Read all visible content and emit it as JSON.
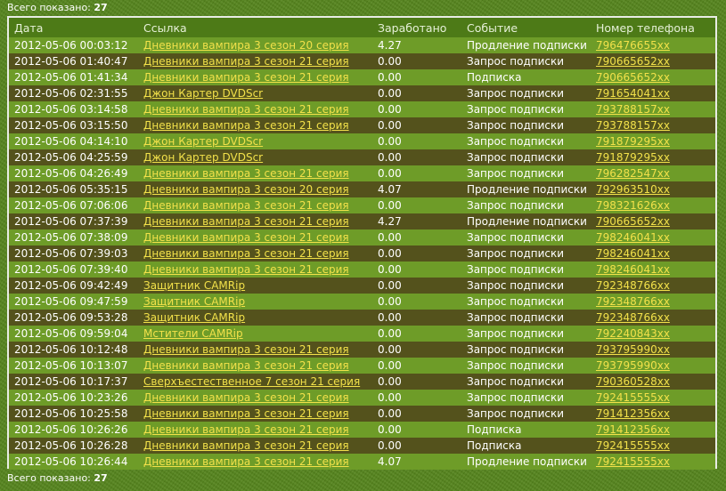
{
  "summary": {
    "label": "Всего показано:",
    "count": "27"
  },
  "columns": [
    "Дата",
    "Ссылка",
    "Заработано",
    "Событие",
    "Номер телефона"
  ],
  "rows": [
    {
      "date": "2012-05-06 00:03:12",
      "link": "Дневники вампира 3 сезон 20 серия",
      "earned": "4.27",
      "event": "Продление подписки",
      "phone": "796476655xx"
    },
    {
      "date": "2012-05-06 01:40:47",
      "link": "Дневники вампира 3 сезон 21 серия",
      "earned": "0.00",
      "event": "Запрос подписки",
      "phone": "790665652xx"
    },
    {
      "date": "2012-05-06 01:41:34",
      "link": "Дневники вампира 3 сезон 21 серия",
      "earned": "0.00",
      "event": "Подписка",
      "phone": "790665652xx"
    },
    {
      "date": "2012-05-06 02:31:55",
      "link": "Джон Картер DVDScr",
      "earned": "0.00",
      "event": "Запрос подписки",
      "phone": "791654041xx"
    },
    {
      "date": "2012-05-06 03:14:58",
      "link": "Дневники вампира 3 сезон 21 серия",
      "earned": "0.00",
      "event": "Запрос подписки",
      "phone": "793788157xx"
    },
    {
      "date": "2012-05-06 03:15:50",
      "link": "Дневники вампира 3 сезон 21 серия",
      "earned": "0.00",
      "event": "Запрос подписки",
      "phone": "793788157xx"
    },
    {
      "date": "2012-05-06 04:14:10",
      "link": "Джон Картер DVDScr",
      "earned": "0.00",
      "event": "Запрос подписки",
      "phone": "791879295xx"
    },
    {
      "date": "2012-05-06 04:25:59",
      "link": "Джон Картер DVDScr",
      "earned": "0.00",
      "event": "Запрос подписки",
      "phone": "791879295xx"
    },
    {
      "date": "2012-05-06 04:26:49",
      "link": "Дневники вампира 3 сезон 21 серия",
      "earned": "0.00",
      "event": "Запрос подписки",
      "phone": "796282547xx"
    },
    {
      "date": "2012-05-06 05:35:15",
      "link": "Дневники вампира 3 сезон 20 серия",
      "earned": "4.07",
      "event": "Продление подписки",
      "phone": "792963510xx"
    },
    {
      "date": "2012-05-06 07:06:06",
      "link": "Дневники вампира 3 сезон 21 серия",
      "earned": "0.00",
      "event": "Запрос подписки",
      "phone": "798321626xx"
    },
    {
      "date": "2012-05-06 07:37:39",
      "link": "Дневники вампира 3 сезон 21 серия",
      "earned": "4.27",
      "event": "Продление подписки",
      "phone": "790665652xx"
    },
    {
      "date": "2012-05-06 07:38:09",
      "link": "Дневники вампира 3 сезон 21 серия",
      "earned": "0.00",
      "event": "Запрос подписки",
      "phone": "798246041xx"
    },
    {
      "date": "2012-05-06 07:39:03",
      "link": "Дневники вампира 3 сезон 21 серия",
      "earned": "0.00",
      "event": "Запрос подписки",
      "phone": "798246041xx"
    },
    {
      "date": "2012-05-06 07:39:40",
      "link": "Дневники вампира 3 сезон 21 серия",
      "earned": "0.00",
      "event": "Запрос подписки",
      "phone": "798246041xx"
    },
    {
      "date": "2012-05-06 09:42:49",
      "link": "Защитник CAMRip",
      "earned": "0.00",
      "event": "Запрос подписки",
      "phone": "792348766xx"
    },
    {
      "date": "2012-05-06 09:47:59",
      "link": "Защитник CAMRip",
      "earned": "0.00",
      "event": "Запрос подписки",
      "phone": "792348766xx"
    },
    {
      "date": "2012-05-06 09:53:28",
      "link": "Защитник CAMRip",
      "earned": "0.00",
      "event": "Запрос подписки",
      "phone": "792348766xx"
    },
    {
      "date": "2012-05-06 09:59:04",
      "link": "Мстители CAMRip",
      "earned": "0.00",
      "event": "Запрос подписки",
      "phone": "792240843xx"
    },
    {
      "date": "2012-05-06 10:12:48",
      "link": "Дневники вампира 3 сезон 21 серия",
      "earned": "0.00",
      "event": "Запрос подписки",
      "phone": "793795990xx"
    },
    {
      "date": "2012-05-06 10:13:07",
      "link": "Дневники вампира 3 сезон 21 серия",
      "earned": "0.00",
      "event": "Запрос подписки",
      "phone": "793795990xx"
    },
    {
      "date": "2012-05-06 10:17:37",
      "link": "Сверхъестественное 7 сезон 21 серия",
      "earned": "0.00",
      "event": "Запрос подписки",
      "phone": "790360528xx"
    },
    {
      "date": "2012-05-06 10:23:26",
      "link": "Дневники вампира 3 сезон 21 серия",
      "earned": "0.00",
      "event": "Запрос подписки",
      "phone": "792415555xx"
    },
    {
      "date": "2012-05-06 10:25:58",
      "link": "Дневники вампира 3 сезон 21 серия",
      "earned": "0.00",
      "event": "Запрос подписки",
      "phone": "791412356xx"
    },
    {
      "date": "2012-05-06 10:26:26",
      "link": "Дневники вампира 3 сезон 21 серия",
      "earned": "0.00",
      "event": "Подписка",
      "phone": "791412356xx"
    },
    {
      "date": "2012-05-06 10:26:28",
      "link": "Дневники вампира 3 сезон 21 серия",
      "earned": "0.00",
      "event": "Подписка",
      "phone": "792415555xx"
    },
    {
      "date": "2012-05-06 10:26:44",
      "link": "Дневники вампира 3 сезон 21 серия",
      "earned": "4.07",
      "event": "Продление подписки",
      "phone": "792415555xx"
    }
  ]
}
